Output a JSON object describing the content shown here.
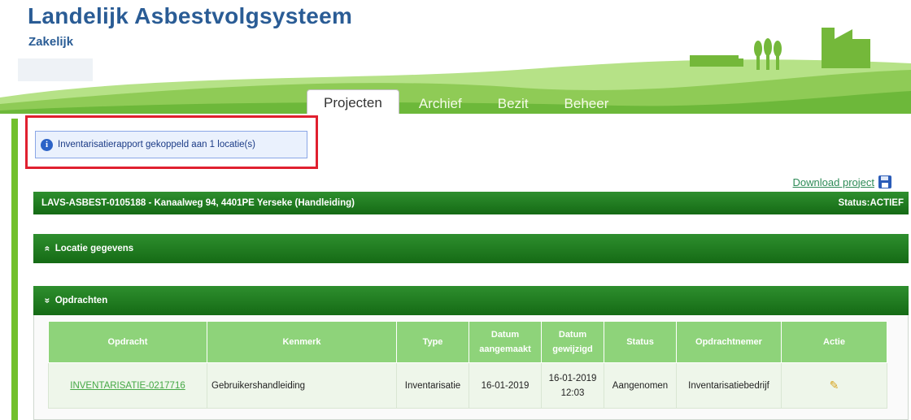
{
  "app": {
    "title": "Landelijk Asbestvolgsysteem",
    "subtitle": "Zakelijk"
  },
  "tabs": [
    {
      "label": "Projecten",
      "active": true
    },
    {
      "label": "Archief",
      "active": false
    },
    {
      "label": "Bezit",
      "active": false
    },
    {
      "label": "Beheer",
      "active": false
    }
  ],
  "info": {
    "icon": "info-icon",
    "glyph": "i",
    "text": "Inventarisatierapport gekoppeld aan 1 locatie(s)"
  },
  "download": {
    "label": "Download project",
    "icon": "floppy-disk-icon"
  },
  "project": {
    "title": "LAVS-ASBEST-0105188 - Kanaalweg 94, 4401PE Yerseke (Handleiding)",
    "status": "Status:ACTIEF"
  },
  "sections": {
    "locatie": {
      "chevron": "«",
      "label": "Locatie gegevens"
    },
    "opdrachten": {
      "chevron": "»",
      "label": "Opdrachten"
    }
  },
  "table": {
    "columns": [
      "Opdracht",
      "Kenmerk",
      "Type",
      "Datum aangemaakt",
      "Datum gewijzigd",
      "Status",
      "Opdrachtnemer",
      "Actie"
    ],
    "rows": [
      {
        "opdracht": "INVENTARISATIE-0217716",
        "kenmerk": "Gebruikershandleiding",
        "type": "Inventarisatie",
        "aangemaakt": "16-01-2019",
        "gewijzigd": "16-01-2019 12:03",
        "status": "Aangenomen",
        "opdrachtnemer": "Inventarisatiebedrijf",
        "actie_icon": "pencil-icon"
      }
    ]
  },
  "colors": {
    "brand_blue": "#2a5c95",
    "header_green": "#1f7a1f",
    "table_header_green": "#8ed37a",
    "highlight_red": "#e0202f"
  }
}
